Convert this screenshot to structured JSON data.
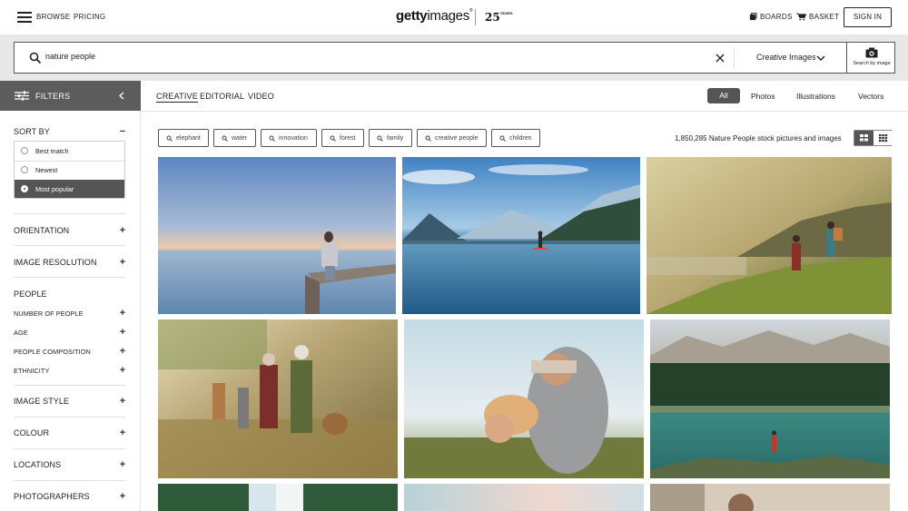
{
  "header": {
    "browse": "BROWSE",
    "pricing": "PRICING",
    "logo_bold": "getty",
    "logo_rest": "images",
    "logo_tm": "®",
    "anniversary_number": "25",
    "anniversary_word": "YEARS",
    "boards": "BOARDS",
    "basket": "BASKET",
    "sign_in": "SIGN IN"
  },
  "search": {
    "query": "nature people",
    "content_type": "Creative Images",
    "search_by_image": "Search by image"
  },
  "filters": {
    "label": "FILTERS",
    "sort_by": "SORT BY",
    "sort_options": [
      "Best match",
      "Newest",
      "Most popular"
    ],
    "selected_sort": "Most popular",
    "orientation": "ORIENTATION",
    "image_resolution": "IMAGE RESOLUTION",
    "people": "PEOPLE",
    "people_sub": [
      "NUMBER OF PEOPLE",
      "AGE",
      "PEOPLE COMPOSITION",
      "ETHNICITY"
    ],
    "image_style": "IMAGE STYLE",
    "colour": "COLOUR",
    "locations": "LOCATIONS",
    "photographers": "PHOTOGRAPHERS"
  },
  "tabs": {
    "items": [
      "CREATIVE",
      "EDITORIAL",
      "VIDEO"
    ],
    "active": "CREATIVE"
  },
  "file_types": {
    "items": [
      "All",
      "Photos",
      "Illustrations",
      "Vectors"
    ],
    "active": "All"
  },
  "related_searches": [
    "elephant",
    "water",
    "innovation",
    "forest",
    "family",
    "creative people",
    "children"
  ],
  "results": {
    "summary": "1,850,285 Nature People stock pictures and images"
  },
  "images": [
    {
      "alt": "woman on pier at sunset"
    },
    {
      "alt": "paddleboarder on mountain lake"
    },
    {
      "alt": "hikers on coastal cliff"
    },
    {
      "alt": "family walking in meadow"
    },
    {
      "alt": "father and daughter playing"
    },
    {
      "alt": "hiker by alpine lake"
    },
    {
      "alt": "waterfall"
    },
    {
      "alt": "sky"
    },
    {
      "alt": "person outdoors"
    }
  ],
  "colors": {
    "dark_panel": "#5c5c5c",
    "search_band": "#e8e8e8"
  }
}
